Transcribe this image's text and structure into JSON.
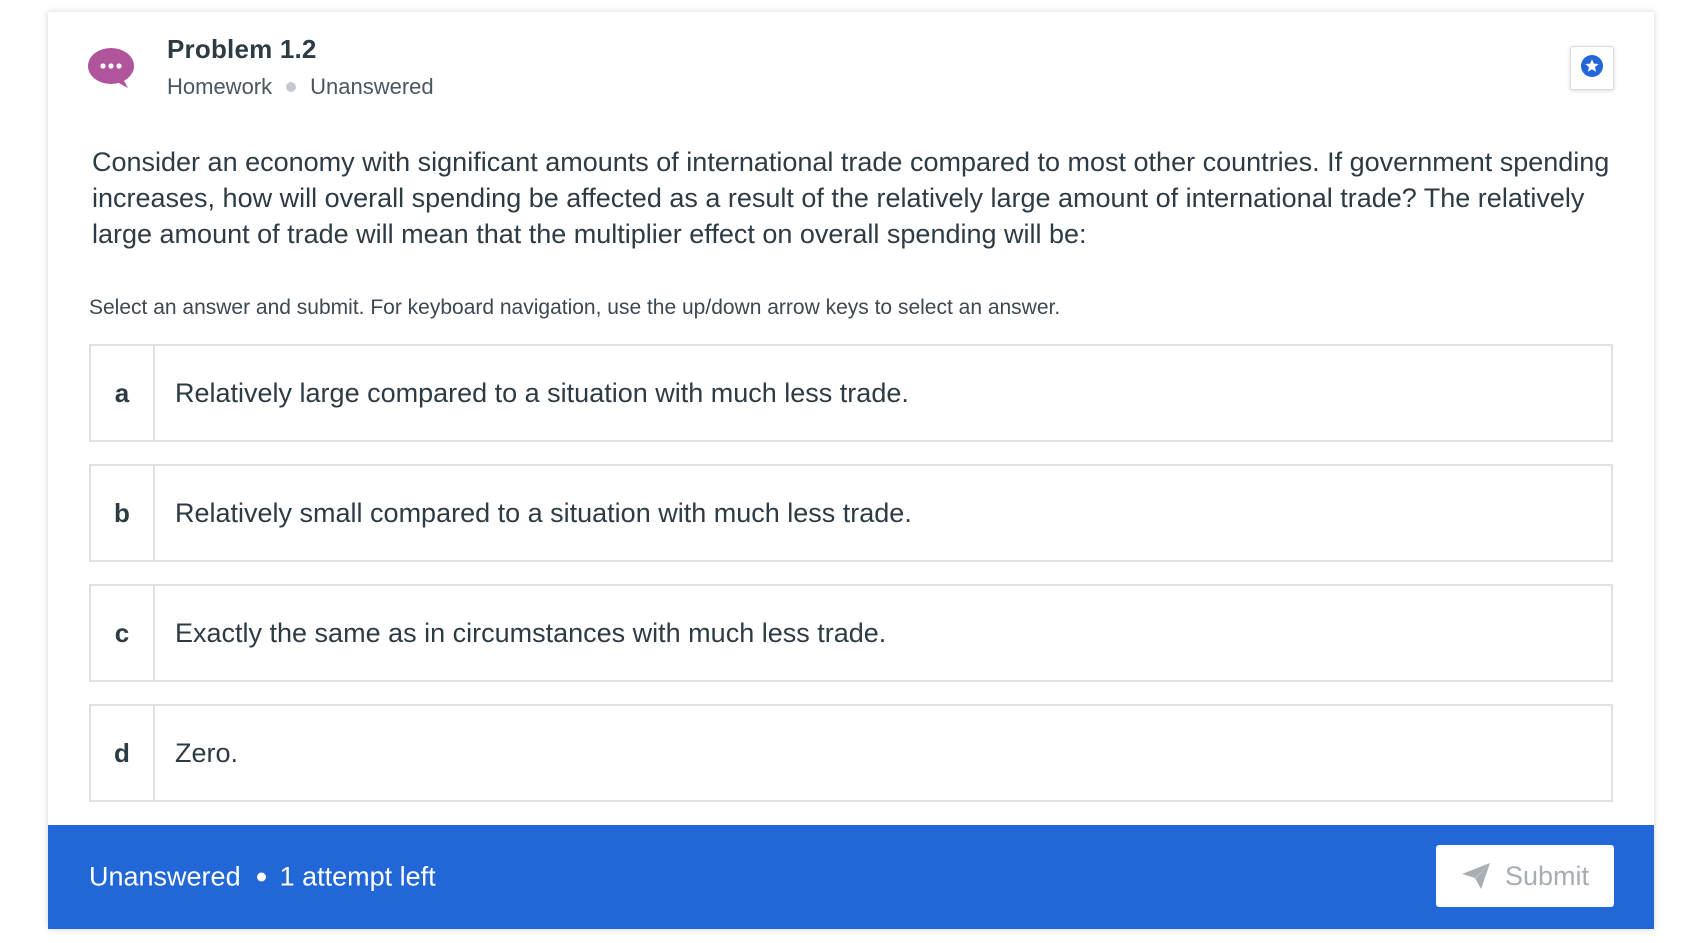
{
  "problem": {
    "title": "Problem 1.2",
    "category": "Homework",
    "status": "Unanswered"
  },
  "question": {
    "text": "Consider an economy with significant amounts of international trade compared to most other countries. If government spending increases, how will overall spending be affected as a result of the relatively large amount of international trade? The relatively large amount of trade will mean that the multiplier effect on overall spending will be:"
  },
  "instructions": "Select an answer and submit. For keyboard navigation, use the up/down arrow keys to select an answer.",
  "choices": [
    {
      "letter": "a",
      "text": "Relatively large compared to a situation with much less trade."
    },
    {
      "letter": "b",
      "text": "Relatively small compared to a situation with much less trade."
    },
    {
      "letter": "c",
      "text": "Exactly the same as in circumstances with much less trade."
    },
    {
      "letter": "d",
      "text": "Zero."
    }
  ],
  "footer": {
    "status": "Unanswered",
    "attempts": "1 attempt left",
    "submit_label": "Submit"
  },
  "icons": {
    "avatar": "chat-bubble-icon",
    "bookmark": "star-badge-icon",
    "submit": "paper-plane-icon"
  },
  "colors": {
    "accent": "#2167d8",
    "avatar": "#b0549b",
    "bookmark": "#2167d8"
  }
}
